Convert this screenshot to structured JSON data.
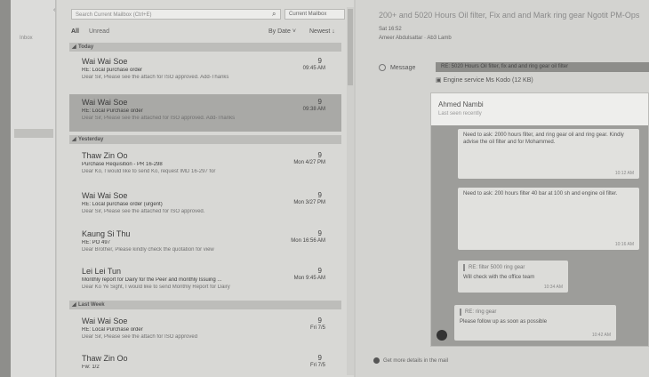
{
  "nav": {
    "item": "Inbox",
    "chevron": "‹"
  },
  "search": {
    "placeholder": "Search Current Mailbox (Ctrl+E)",
    "scope": "Current Mailbox"
  },
  "filter": {
    "all": "All",
    "unread": "Unread",
    "sort": "By Date ˅",
    "order": "Newest ↓"
  },
  "groups": [
    {
      "label": "Today"
    },
    {
      "label": "Yesterday"
    },
    {
      "label": "Last Week"
    }
  ],
  "emails": [
    {
      "sender": "Wai Wai Soe",
      "subject": "RE: Local purchase order",
      "preview": "Dear Sir, Please see the attach for ISO approved. Add-Thanks",
      "count": "9",
      "time": "09:45 AM"
    },
    {
      "sender": "Wai Wai Soe",
      "subject": "RE: Local Purchase order",
      "preview": "Dear Sir, Please see the attached for ISO approved. Add-Thanks",
      "count": "9",
      "time": "09:38 AM"
    },
    {
      "sender": "Thaw Zin Oo",
      "subject": "Purchase Requisition - PR 16-298",
      "preview": "Dear Ko, I would like to send Ko, request IMD 16-297 for",
      "count": "9",
      "time": "Mon 4/27 PM"
    },
    {
      "sender": "Wai Wai Soe",
      "subject": "RE: Local purchase order (urgent)",
      "preview": "Dear Sir, Please see the attached for ISO approved.",
      "count": "9",
      "time": "Mon 3/27 PM"
    },
    {
      "sender": "Kaung Si Thu",
      "subject": "RE: PO 497",
      "preview": "Dear Brother, Please kindly check the quotation for view",
      "count": "9",
      "time": "Mon 16:56 AM"
    },
    {
      "sender": "Lei Lei Tun",
      "subject": "Monthly report for Dairy for the Peer and monthly Issuing ...",
      "preview": "Dear Ko Ye Sight, I would like to send Monthly Report for Dairy",
      "count": "9",
      "time": "Mon 9:45 AM"
    },
    {
      "sender": "Wai Wai Soe",
      "subject": "RE: Local Purchase order",
      "preview": "Dear Sir, Please see the attach for ISO approved",
      "count": "9",
      "time": "Fri 7/5"
    },
    {
      "sender": "Thaw Zin Oo",
      "subject": "Fw: 1/2",
      "preview": "",
      "count": "9",
      "time": "Fri 7/5"
    }
  ],
  "reading": {
    "subject": "200+ and 5020 Hours Oil filter, Fix and and Mark ring gear Ngotit PM-Ops",
    "meta1": "Sat 16:52",
    "meta2": "Ameer Abdulsattar · Ab3 Lamb",
    "message_label": "Message",
    "attachment1": "RE: 5020 Hours Oil filter, fix and and ring gear oil filter",
    "attachment2": "Engine service Ms Kodo (12 KB)",
    "chat_title": "Ahmed Nambi",
    "chat_status": "Last seen recently",
    "bubble1": "Need to ask: 2000 hours filter, and ring gear oil and ring gear. Kindly advise the oil filter and for Mohammed.",
    "bubble1_time": "10:12 AM",
    "bubble2": "Need to ask: 200 hours filter 40 bar at 100 sh and engine oil filter.",
    "bubble2_time": "10:16 AM",
    "reply1_quote": "RE: filter 5000 ring gear",
    "reply1": "Will check with the office team",
    "reply1_time": "10:34 AM",
    "reply2_quote": "RE: ring gear",
    "reply2": "Please follow up as soon as possible",
    "reply2_time": "10:42 AM",
    "footer": "Get more details in the mail"
  }
}
